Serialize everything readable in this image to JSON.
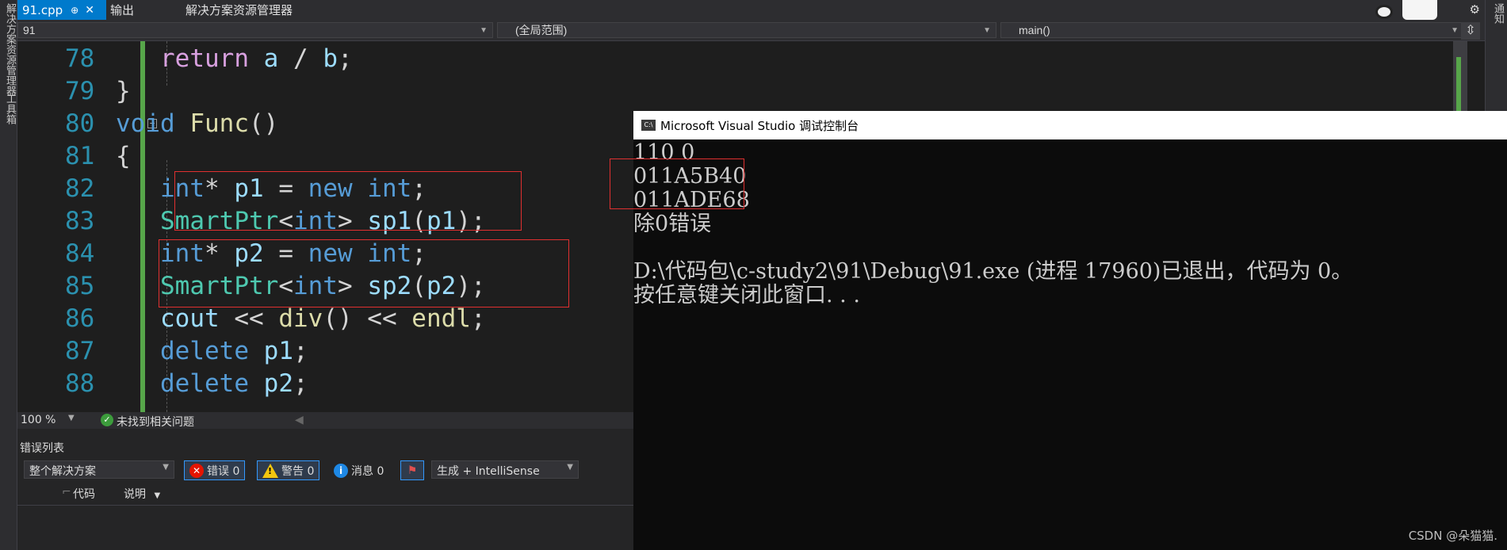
{
  "side": {
    "left_labels": [
      "解决方案资源管理器",
      "工具箱"
    ],
    "right_label": "通知"
  },
  "tabs": {
    "active": {
      "label": "91.cpp",
      "pin": "⊕",
      "close": "✕"
    },
    "output": "输出",
    "solution_explorer": "解决方案资源管理器",
    "gear": "⚙"
  },
  "navbar": {
    "project": "91",
    "scope": "(全局范围)",
    "member": "main()",
    "split": "⇳"
  },
  "editor": {
    "lines": [
      {
        "n": "78",
        "tokens": [
          [
            "ctl",
            "return"
          ],
          [
            "pl",
            " "
          ],
          [
            "var",
            "a"
          ],
          [
            "pl",
            " / "
          ],
          [
            "var",
            "b"
          ],
          [
            "pl",
            ";"
          ]
        ]
      },
      {
        "n": "79",
        "tokens": [
          [
            "pl",
            "}"
          ]
        ]
      },
      {
        "n": "80",
        "tokens": [
          [
            "kw",
            "void"
          ],
          [
            "pl",
            " "
          ],
          [
            "fn",
            "Func"
          ],
          [
            "pl",
            "()"
          ]
        ]
      },
      {
        "n": "81",
        "tokens": [
          [
            "pl",
            "{"
          ]
        ]
      },
      {
        "n": "82",
        "tokens": [
          [
            "kw",
            "int"
          ],
          [
            "pl",
            "* "
          ],
          [
            "var",
            "p1"
          ],
          [
            "pl",
            " = "
          ],
          [
            "kw",
            "new"
          ],
          [
            "pl",
            " "
          ],
          [
            "kw",
            "int"
          ],
          [
            "pl",
            ";"
          ]
        ]
      },
      {
        "n": "83",
        "tokens": [
          [
            "ty",
            "SmartPtr"
          ],
          [
            "pl",
            "<"
          ],
          [
            "kw",
            "int"
          ],
          [
            "pl",
            "> "
          ],
          [
            "var",
            "sp1"
          ],
          [
            "pl",
            "("
          ],
          [
            "var",
            "p1"
          ],
          [
            "pl",
            ");"
          ]
        ]
      },
      {
        "n": "84",
        "tokens": [
          [
            "kw",
            "int"
          ],
          [
            "pl",
            "* "
          ],
          [
            "var",
            "p2"
          ],
          [
            "pl",
            " = "
          ],
          [
            "kw",
            "new"
          ],
          [
            "pl",
            " "
          ],
          [
            "kw",
            "int"
          ],
          [
            "pl",
            ";"
          ]
        ]
      },
      {
        "n": "85",
        "tokens": [
          [
            "ty",
            "SmartPtr"
          ],
          [
            "pl",
            "<"
          ],
          [
            "kw",
            "int"
          ],
          [
            "pl",
            "> "
          ],
          [
            "var",
            "sp2"
          ],
          [
            "pl",
            "("
          ],
          [
            "var",
            "p2"
          ],
          [
            "pl",
            ");"
          ]
        ]
      },
      {
        "n": "86",
        "tokens": [
          [
            "var",
            "cout"
          ],
          [
            "pl",
            " << "
          ],
          [
            "fn",
            "div"
          ],
          [
            "pl",
            "() << "
          ],
          [
            "fn",
            "endl"
          ],
          [
            "pl",
            ";"
          ]
        ]
      },
      {
        "n": "87",
        "tokens": [
          [
            "kw",
            "delete"
          ],
          [
            "pl",
            " "
          ],
          [
            "var",
            "p1"
          ],
          [
            "pl",
            ";"
          ]
        ]
      },
      {
        "n": "88",
        "tokens": [
          [
            "kw",
            "delete"
          ],
          [
            "pl",
            " "
          ],
          [
            "var",
            "p2"
          ],
          [
            "pl",
            ";"
          ]
        ]
      }
    ]
  },
  "status": {
    "zoom": "100 %",
    "issues": "未找到相关问题"
  },
  "error_list": {
    "title": "错误列表",
    "scope": "整个解决方案",
    "errors": "错误 0",
    "warnings": "警告 0",
    "messages": "消息 0",
    "build": "生成 + IntelliSense",
    "col_code": "代码",
    "col_desc": "说明"
  },
  "console": {
    "title": "Microsoft Visual Studio 调试控制台",
    "icon_text": "C:\\",
    "lines": [
      "110 0",
      "011A5B40",
      "011ADE68",
      "除0错误",
      "",
      "D:\\代码包\\c-study2\\91\\Debug\\91.exe (进程 17960)已退出，代码为 0。",
      "按任意键关闭此窗口. . ."
    ],
    "watermark": "CSDN @朵猫猫."
  }
}
